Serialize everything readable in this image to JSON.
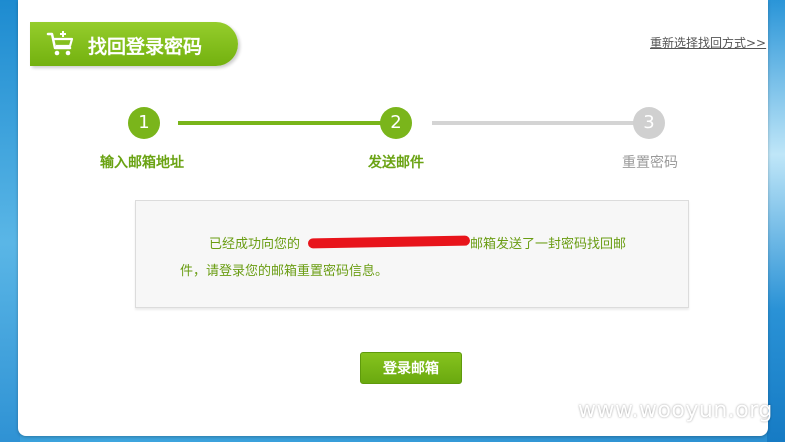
{
  "header": {
    "title": "找回登录密码",
    "reselect_link": "重新选择找回方式>>"
  },
  "steps": [
    {
      "number": "1",
      "label": "输入邮箱地址",
      "state": "done"
    },
    {
      "number": "2",
      "label": "发送邮件",
      "state": "current"
    },
    {
      "number": "3",
      "label": "重置密码",
      "state": "pending"
    }
  ],
  "message": {
    "line1_prefix": "已经成功向您的",
    "line1_suffix": "邮箱发送了一封密码找回邮",
    "line2": "件，请登录您的邮箱重置密码信息。"
  },
  "actions": {
    "login_mail_label": "登录邮箱"
  },
  "watermark": "www.wooyun.org",
  "colors": {
    "accent": "#7ab51b",
    "inactive": "#d0d0d0",
    "redaction": "#e8141b"
  }
}
